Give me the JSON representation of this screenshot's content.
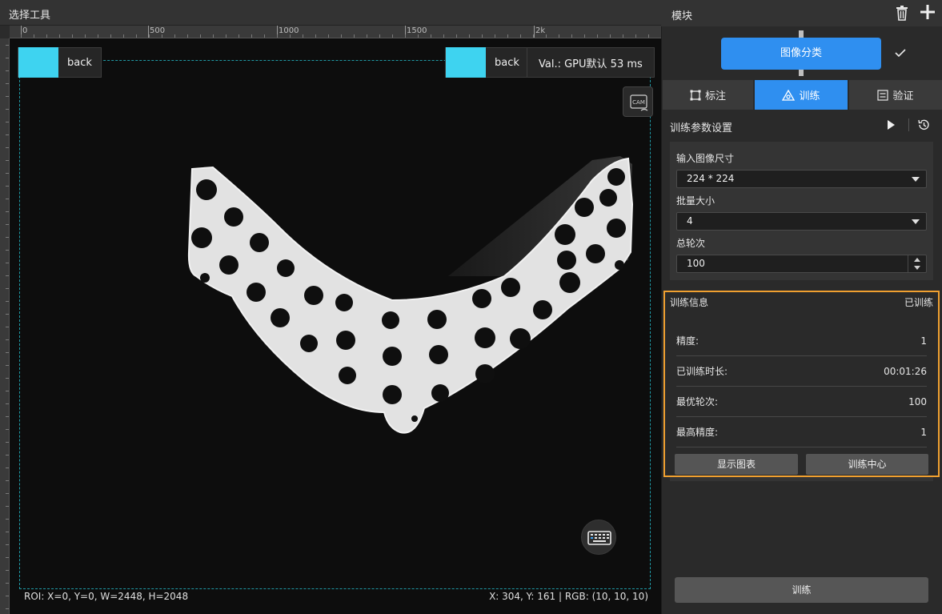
{
  "tool": {
    "title": "选择工具"
  },
  "ruler": {
    "top_labels": [
      "0",
      "500",
      "1000",
      "1500",
      "2k"
    ]
  },
  "viewport": {
    "left_badge": "back",
    "right_badge": "back",
    "val_text": "Val.:  GPU默认 53 ms",
    "cam_label": "CAM",
    "roi_text": "ROI: X=0, Y=0, W=2448, H=2048",
    "coord_text": "X: 304, Y: 161 | RGB: (10, 10, 10)",
    "accent_color": "#3ed3f0",
    "roi_border_color": "#1f9aa6"
  },
  "panel": {
    "title": "模块",
    "module_node": "图像分类",
    "module_color": "#2f8ff0",
    "tabs": [
      {
        "label": "标注",
        "icon": "annotate-icon",
        "active": false
      },
      {
        "label": "训练",
        "icon": "train-icon",
        "active": true
      },
      {
        "label": "验证",
        "icon": "verify-icon",
        "active": false
      }
    ],
    "params": {
      "title": "训练参数设置",
      "input_size_label": "输入图像尺寸",
      "input_size_value": "224 * 224",
      "batch_label": "批量大小",
      "batch_value": "4",
      "epochs_label": "总轮次",
      "epochs_value": "100"
    },
    "info": {
      "title": "训练信息",
      "status": "已训练",
      "highlight_color": "#f0a030",
      "rows": [
        {
          "label": "精度:",
          "value": "1"
        },
        {
          "label": "已训练时长:",
          "value": "00:01:26"
        },
        {
          "label": "最优轮次:",
          "value": "100"
        },
        {
          "label": "最高精度:",
          "value": "1"
        }
      ],
      "show_chart_button": "显示图表",
      "training_center_button": "训练中心"
    },
    "train_button": "训练"
  }
}
